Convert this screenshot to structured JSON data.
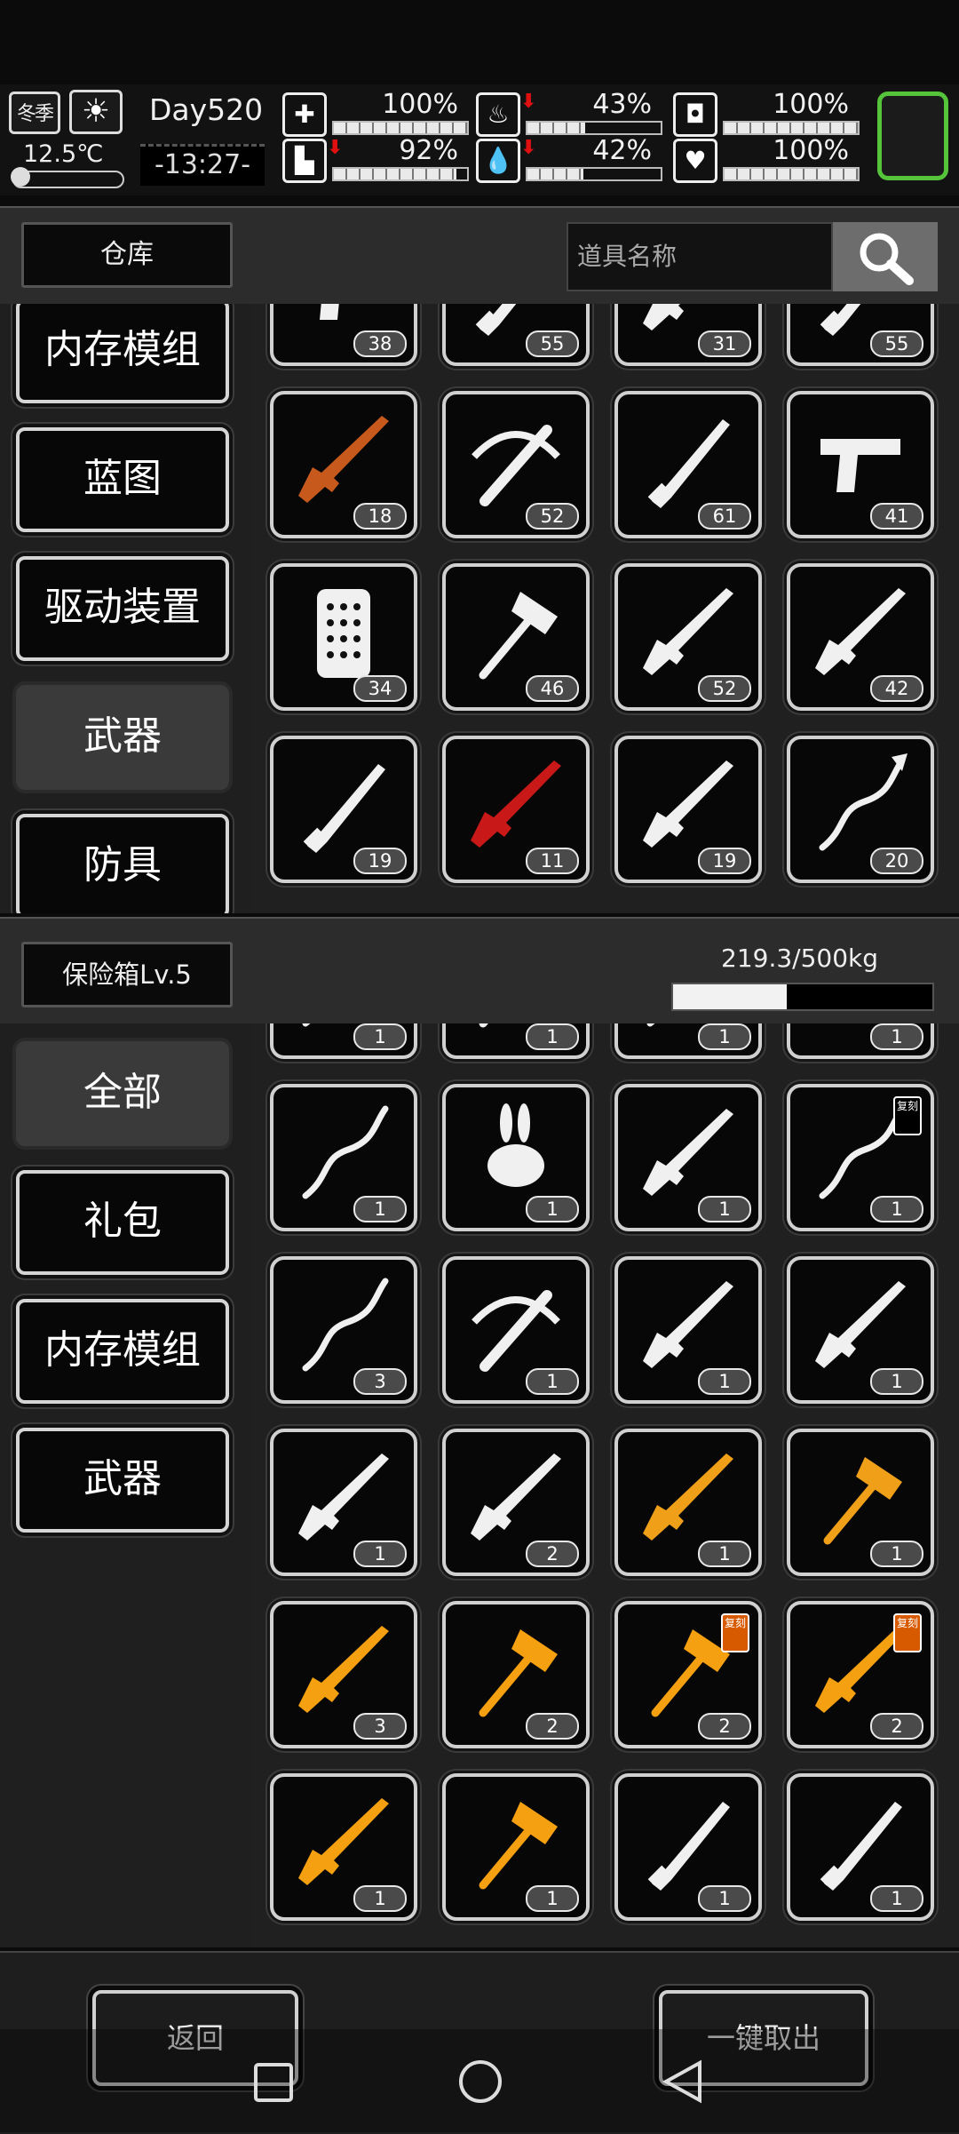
{
  "status": {
    "season": "冬季",
    "weather_icon": "sun-icon",
    "temperature": "12.5℃",
    "day": "Day520",
    "clock": "-13:27-",
    "stats": [
      {
        "name": "health",
        "icon": "medkit-icon",
        "value": "100%",
        "fraction": 1.0,
        "arrow": false
      },
      {
        "name": "stomach",
        "icon": "stomach-icon",
        "value": "43%",
        "fraction": 0.43,
        "arrow": true
      },
      {
        "name": "armor",
        "icon": "helmet-icon",
        "value": "100%",
        "fraction": 1.0,
        "arrow": false
      },
      {
        "name": "stamina",
        "icon": "boot-icon",
        "value": "92%",
        "fraction": 0.92,
        "arrow": true
      },
      {
        "name": "water",
        "icon": "water-drop-icon",
        "value": "42%",
        "fraction": 0.42,
        "arrow": true
      },
      {
        "name": "mood",
        "icon": "heart-icon",
        "value": "100%",
        "fraction": 1.0,
        "arrow": false
      }
    ]
  },
  "warehouse": {
    "title": "仓库",
    "search_placeholder": "道具名称",
    "categories": [
      "内存模组",
      "蓝图",
      "驱动装置",
      "武器",
      "防具"
    ],
    "active_category": "武器",
    "items": [
      {
        "icon": "revolver-icon",
        "count": "38",
        "color": "#f0f0f0"
      },
      {
        "icon": "machete-icon",
        "count": "55",
        "color": "#f0f0f0"
      },
      {
        "icon": "rifle-icon",
        "count": "31",
        "color": "#f0f0f0"
      },
      {
        "icon": "knife-icon",
        "count": "55",
        "color": "#f0f0f0"
      },
      {
        "icon": "rocket-launcher-icon",
        "count": "18",
        "color": "#c8591c"
      },
      {
        "icon": "crossbow-icon",
        "count": "52",
        "color": "#f0f0f0"
      },
      {
        "icon": "broadsword-icon",
        "count": "61",
        "color": "#f0f0f0"
      },
      {
        "icon": "pistol-icon",
        "count": "41",
        "color": "#f0f0f0"
      },
      {
        "icon": "riot-shield-icon",
        "count": "34",
        "color": "#f0f0f0"
      },
      {
        "icon": "axe-icon",
        "count": "46",
        "color": "#f0f0f0"
      },
      {
        "icon": "rifle-icon",
        "count": "52",
        "color": "#f0f0f0"
      },
      {
        "icon": "rifle-icon",
        "count": "42",
        "color": "#f0f0f0"
      },
      {
        "icon": "combat-knife-icon",
        "count": "19",
        "color": "#f0f0f0"
      },
      {
        "icon": "shotgun-icon",
        "count": "11",
        "color": "#c81818"
      },
      {
        "icon": "shotgun-icon",
        "count": "19",
        "color": "#f0f0f0"
      },
      {
        "icon": "spear-icon",
        "count": "20",
        "color": "#f0f0f0"
      }
    ]
  },
  "safebox": {
    "title": "保险箱Lv.5",
    "weight_text": "219.3/500kg",
    "weight_fraction": 0.4386,
    "categories": [
      "全部",
      "礼包",
      "内存模组",
      "武器"
    ],
    "active_category": "全部",
    "items": [
      {
        "icon": "staff-icon",
        "count": "1",
        "color": "#f0f0f0",
        "badge": ""
      },
      {
        "icon": "hammer-icon",
        "count": "1",
        "color": "#f0f0f0",
        "badge": ""
      },
      {
        "icon": "dragon-staff-icon",
        "count": "1",
        "color": "#f0f0f0",
        "badge": ""
      },
      {
        "icon": "pagoda-icon",
        "count": "1",
        "color": "#f0f0f0",
        "badge": ""
      },
      {
        "icon": "whip-icon",
        "count": "1",
        "color": "#f0f0f0",
        "badge": ""
      },
      {
        "icon": "rabbit-icon",
        "count": "1",
        "color": "#f0f0f0",
        "badge": ""
      },
      {
        "icon": "cannon-gun-icon",
        "count": "1",
        "color": "#f0f0f0",
        "badge": ""
      },
      {
        "icon": "chain-whip-icon",
        "count": "1",
        "color": "#f0f0f0",
        "badge": "复刻"
      },
      {
        "icon": "chain-whip-icon",
        "count": "3",
        "color": "#f0f0f0",
        "badge": ""
      },
      {
        "icon": "crossbow-icon",
        "count": "1",
        "color": "#f0f0f0",
        "badge": ""
      },
      {
        "icon": "dragon-sniper-icon",
        "count": "1",
        "color": "#f0f0f0",
        "badge": ""
      },
      {
        "icon": "dragon-gun-icon",
        "count": "1",
        "color": "#f0f0f0",
        "badge": ""
      },
      {
        "icon": "dragon-rifle-icon",
        "count": "1",
        "color": "#f0f0f0",
        "badge": ""
      },
      {
        "icon": "bazooka-icon",
        "count": "2",
        "color": "#f0f0f0",
        "badge": ""
      },
      {
        "icon": "golden-shotgun-icon",
        "count": "1",
        "color": "#f0a018",
        "badge": ""
      },
      {
        "icon": "golden-hammer-icon",
        "count": "1",
        "color": "#f0a018",
        "badge": ""
      },
      {
        "icon": "golden-gun-icon",
        "count": "3",
        "color": "#f5a010",
        "badge": ""
      },
      {
        "icon": "golden-axe-icon",
        "count": "2",
        "color": "#f5a010",
        "badge": ""
      },
      {
        "icon": "golden-axe-icon",
        "count": "2",
        "color": "#f5a010",
        "badge": "复刻"
      },
      {
        "icon": "golden-gun-icon",
        "count": "2",
        "color": "#f5a010",
        "badge": "复刻"
      },
      {
        "icon": "golden-gun-icon",
        "count": "1",
        "color": "#f5a010",
        "badge": ""
      },
      {
        "icon": "golden-lion-mace-icon",
        "count": "1",
        "color": "#f5a010",
        "badge": ""
      },
      {
        "icon": "katana-icon",
        "count": "1",
        "color": "#f0f0f0",
        "badge": ""
      },
      {
        "icon": "long-sword-icon",
        "count": "1",
        "color": "#f0f0f0",
        "badge": ""
      }
    ]
  },
  "footer": {
    "back_label": "返回",
    "take_all_label": "一键取出"
  },
  "nav": [
    "recent-apps-icon",
    "home-icon",
    "back-icon"
  ]
}
